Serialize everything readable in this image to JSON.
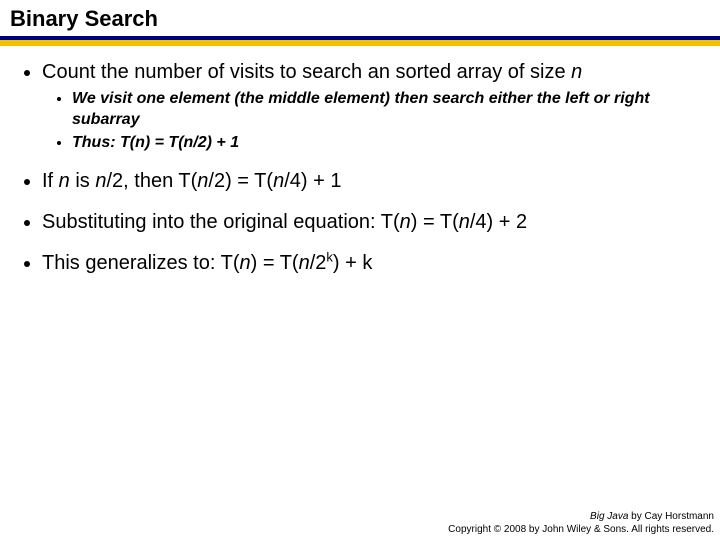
{
  "title": "Binary Search",
  "bullets": {
    "b1_pre": "Count the number of visits to search an sorted array of size ",
    "b1_n": "n",
    "sub1": "We visit one element (the middle element) then search either the left or right subarray",
    "sub2": "Thus: T(n) = T(n/2) + 1",
    "b2_a": "If ",
    "b2_n1": "n",
    "b2_b": " is ",
    "b2_n2": "n",
    "b2_c": "/2, then T(",
    "b2_n3": "n",
    "b2_d": "/2) = T(",
    "b2_n4": "n",
    "b2_e": "/4) + 1",
    "b3_a": "Substituting into the original equation: T(",
    "b3_n1": "n",
    "b3_b": ") = T(",
    "b3_n2": "n",
    "b3_c": "/4) + 2",
    "b4_a": "This generalizes to: T(",
    "b4_n1": "n",
    "b4_b": ") = T(",
    "b4_n2": "n",
    "b4_c": "/2",
    "b4_k": "k",
    "b4_d": ") + k"
  },
  "footer": {
    "line1_em": "Big Java",
    "line1_rest": " by Cay Horstmann",
    "line2": "Copyright © 2008 by John Wiley & Sons.  All rights reserved."
  }
}
